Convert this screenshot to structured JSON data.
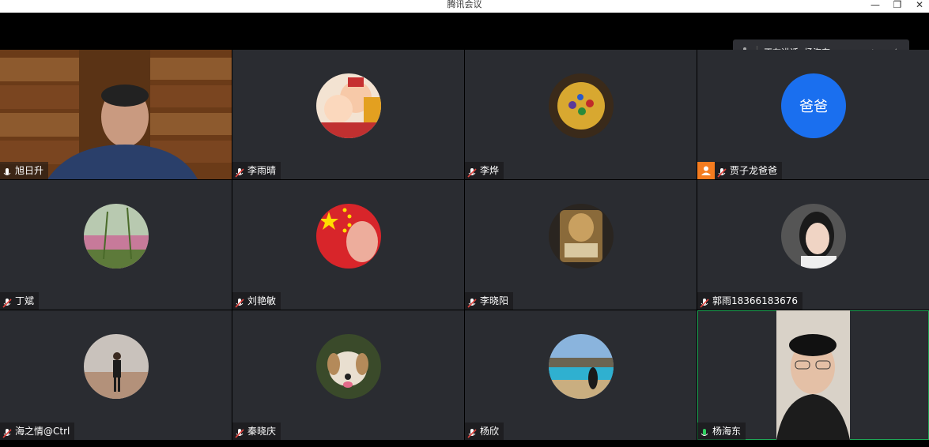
{
  "window": {
    "title": "腾讯会议"
  },
  "speaking_indicator": {
    "label": "正在讲话: 杨海东;"
  },
  "participants": [
    {
      "name": "旭日升",
      "muted": false,
      "avatar": "video-host"
    },
    {
      "name": "李雨晴",
      "muted": true,
      "avatar": "cartoon-avatar"
    },
    {
      "name": "李烨",
      "muted": true,
      "avatar": "thanos-avatar"
    },
    {
      "name": "贾子龙爸爸",
      "muted": true,
      "avatar_text": "爸爸"
    },
    {
      "name": "丁斌",
      "muted": true,
      "avatar": "flower-field-avatar"
    },
    {
      "name": "刘艳敏",
      "muted": true,
      "avatar": "china-flag-avatar"
    },
    {
      "name": "李晓阳",
      "muted": true,
      "avatar": "game-card-avatar"
    },
    {
      "name": "郭雨18366183676",
      "muted": true,
      "avatar": "woman-avatar"
    },
    {
      "name": "海之情@Ctrl",
      "muted": true,
      "avatar": "beach-man-avatar"
    },
    {
      "name": "秦晓庆",
      "muted": true,
      "avatar": "dog-avatar"
    },
    {
      "name": "杨欣",
      "muted": true,
      "avatar": "lake-avatar"
    },
    {
      "name": "杨海东",
      "muted": false,
      "speaking": true,
      "avatar": "video-self"
    }
  ],
  "colors": {
    "tile_bg": "#2a2c31",
    "accent_blue": "#1a6fef",
    "active_green": "#1fa556",
    "muted_red": "#e0443e",
    "badge_orange": "#f57c1f"
  }
}
